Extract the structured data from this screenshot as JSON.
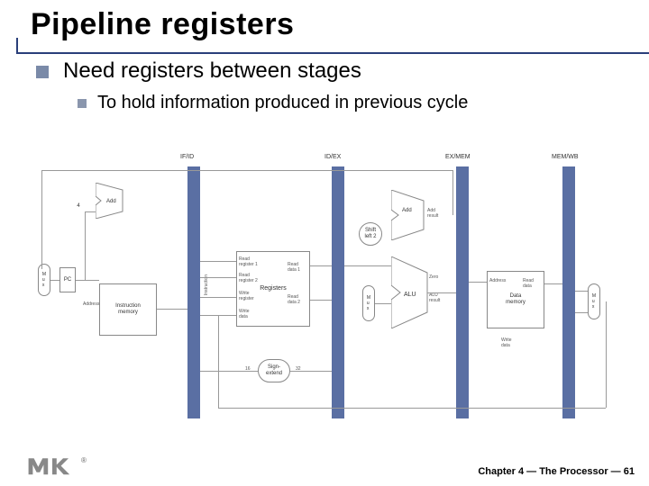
{
  "slide": {
    "title": "Pipeline registers",
    "bullets": [
      {
        "text": "Need registers between stages",
        "level": 1
      },
      {
        "text": "To hold information produced in previous cycle",
        "level": 2
      }
    ]
  },
  "diagram": {
    "pipeline_registers": [
      "IF/ID",
      "ID/EX",
      "EX/MEM",
      "MEM/WB"
    ],
    "blocks": {
      "pc": "PC",
      "imem": "Instruction\nmemory",
      "add1": "Add",
      "add2": "Add",
      "add_result": "Add\nresult",
      "shift": "Shift\nleft 2",
      "regfile": "Registers",
      "regfile_ports": [
        "Read\nregister 1",
        "Read\nregister 2",
        "Write\nregister",
        "Write\ndata",
        "Read\ndata 1",
        "Read\ndata 2"
      ],
      "signext": "Sign-\nextend",
      "signext_in": "16",
      "signext_out": "32",
      "alu": "ALU",
      "alu_zero": "Zero",
      "alu_result": "ALU\nresult",
      "dmem": "Data\nmemory",
      "dmem_ports": [
        "Address",
        "Read\ndata",
        "Write\ndata"
      ],
      "mux": "M\nu\nx",
      "const_4": "4",
      "instr_label": "Instruction",
      "address_label": "Address"
    }
  },
  "footer": {
    "chapter": "Chapter 4",
    "title": "The Processor",
    "page": "61",
    "sep": " — "
  },
  "logo": {
    "text": "MK",
    "registered": "®"
  }
}
